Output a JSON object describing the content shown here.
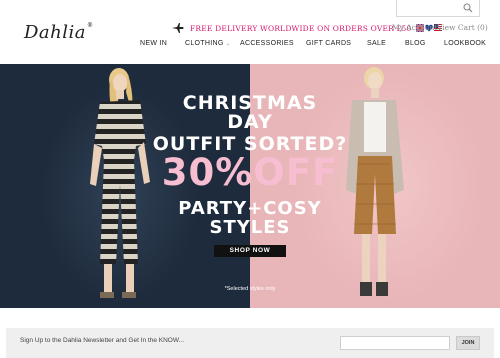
{
  "brand": {
    "logo_text": "Dahlia",
    "registered_mark": "®"
  },
  "search": {
    "placeholder": ""
  },
  "promo": {
    "text": "FREE DELIVERY WORLDWIDE ON ORDERS OVER £50",
    "color": "#d6156d"
  },
  "account": {
    "my_account": "My Account",
    "view_cart": "View Cart (0)"
  },
  "nav": {
    "items": [
      {
        "label": "NEW IN"
      },
      {
        "label": "CLOTHING",
        "has_dropdown": true
      },
      {
        "label": "ACCESSORIES"
      },
      {
        "label": "GIFT CARDS"
      },
      {
        "label": "SALE"
      },
      {
        "label": "BLOG"
      },
      {
        "label": "LOOKBOOK"
      }
    ]
  },
  "hero": {
    "line1": "CHRISTMAS",
    "line2": "DAY",
    "line3": "OUTFIT SORTED?",
    "discount": "30%OFF",
    "line4": "PARTY+COSY",
    "line5": "STYLES",
    "cta": "SHOP NOW",
    "note": "*Selected styles only",
    "colors": {
      "left_bg": "#1e2b3c",
      "right_bg": "#e8b5b8",
      "discount": "#f7bdd0"
    }
  },
  "newsletter": {
    "text": "Sign Up to the Dahlia Newsletter and Get In the KNOW...",
    "input_placeholder": "",
    "button_label": "JOIN"
  }
}
